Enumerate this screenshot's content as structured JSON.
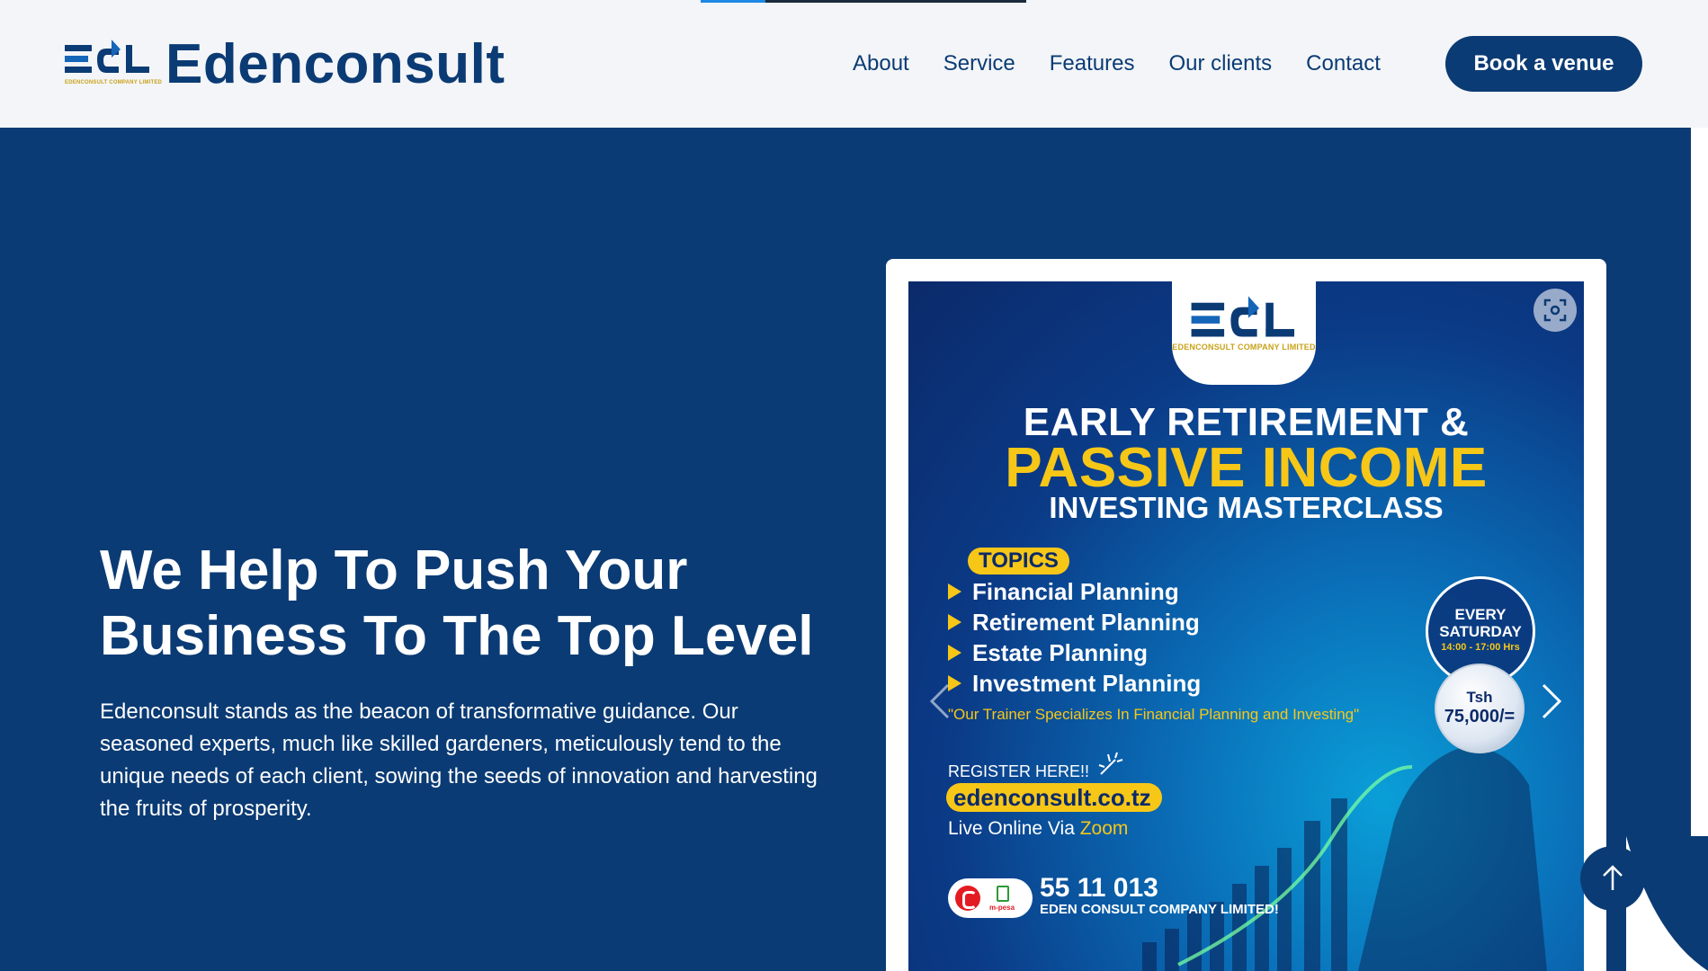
{
  "header": {
    "brand_name": "Edenconsult",
    "logo_mark_text": "ECL",
    "logo_tagline": "EDENCONSULT COMPANY LIMITED",
    "nav": [
      {
        "label": "About"
      },
      {
        "label": "Service"
      },
      {
        "label": "Features"
      },
      {
        "label": "Our clients"
      },
      {
        "label": "Contact"
      }
    ],
    "cta_label": "Book a venue"
  },
  "hero": {
    "title": "We Help To Push Your Business To The Top Level",
    "description": "Edenconsult stands as the beacon of transformative guidance. Our seasoned experts, much like skilled gardeners, meticulously tend to the unique needs of each client, sowing the seeds of innovation and harvesting the fruits of prosperity."
  },
  "poster": {
    "logo_tagline": "EDENCONSULT COMPANY LIMITED",
    "line1": "EARLY RETIREMENT &",
    "line2": "PASSIVE INCOME",
    "line3": "INVESTING MASTERCLASS",
    "topics_label": "TOPICS",
    "topics": [
      "Financial Planning",
      "Retirement Planning",
      "Estate Planning",
      "Investment Planning"
    ],
    "quote": "\"Our Trainer Specializes In Financial Planning and Investing\"",
    "schedule_line1": "EVERY",
    "schedule_line2": "SATURDAY",
    "schedule_time": "14:00 - 17:00 Hrs",
    "price_currency": "Tsh",
    "price_value": "75,000/=",
    "register_label": "REGISTER HERE!!",
    "url": "edenconsult.co.tz",
    "live_prefix": "Live Online Via",
    "live_platform": "Zoom",
    "payment_label": "m-pesa",
    "phone": "55 11 013",
    "company": "EDEN CONSULT COMPANY LIMITED!"
  },
  "colors": {
    "primary": "#0b3b74",
    "accent_yellow": "#f7c718",
    "header_bg": "#f3f5f8",
    "progress_blue": "#1e88e5"
  },
  "icons": {
    "scan": "scan-icon",
    "prev": "chevron-left-icon",
    "next": "chevron-right-icon",
    "scroll_top": "arrow-up-icon"
  }
}
